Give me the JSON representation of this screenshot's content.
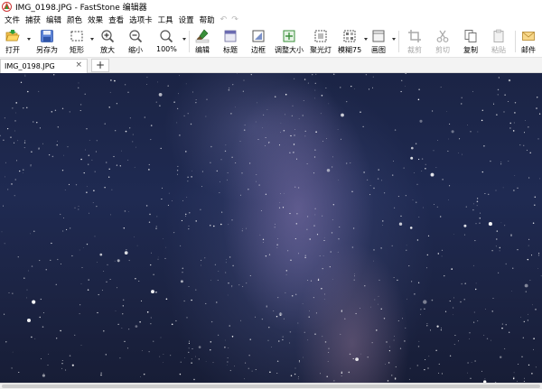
{
  "window": {
    "title": "IMG_0198.JPG - FastStone 编辑器"
  },
  "menu": {
    "items": [
      "文件",
      "捕获",
      "编辑",
      "颜色",
      "效果",
      "查看",
      "选项卡",
      "工具",
      "设置",
      "帮助"
    ],
    "undo": "↶",
    "redo": "↷"
  },
  "toolbar": {
    "open": "打开",
    "save_as": "另存为",
    "rect": "矩形",
    "zoom_in": "放大",
    "zoom_out": "缩小",
    "zoom_level": "100%",
    "edit": "编辑",
    "caption": "标题",
    "border": "边框",
    "resize": "调整大小",
    "spotlight": "聚光灯",
    "blur": "模糊75",
    "canvas": "画图",
    "crop": "裁剪",
    "cut": "剪切",
    "copy": "复制",
    "paste": "粘贴",
    "email": "邮件"
  },
  "tabs": {
    "active": "IMG_0198.JPG",
    "close": "×",
    "add": "+"
  },
  "colors": {
    "sky_dark": "#1b2445",
    "milky_way": "#8c7eb8",
    "accent_green": "#2e9e3c",
    "accent_blue": "#3b6fc9"
  }
}
